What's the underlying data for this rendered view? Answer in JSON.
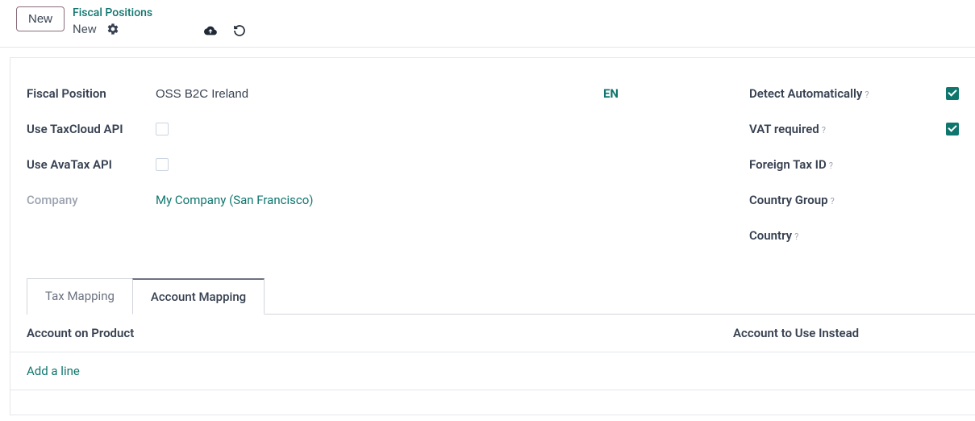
{
  "topbar": {
    "new_button": "New",
    "breadcrumb_parent": "Fiscal Positions",
    "breadcrumb_current": "New"
  },
  "form": {
    "left": {
      "fiscal_position_label": "Fiscal Position",
      "fiscal_position_value": "OSS B2C Ireland",
      "lang_badge": "EN",
      "use_taxcloud_label": "Use TaxCloud API",
      "use_taxcloud_checked": false,
      "use_avatax_label": "Use AvaTax API",
      "use_avatax_checked": false,
      "company_label": "Company",
      "company_value": "My Company (San Francisco)"
    },
    "right": {
      "detect_auto_label": "Detect Automatically",
      "detect_auto_checked": true,
      "vat_required_label": "VAT required",
      "vat_required_checked": true,
      "foreign_tax_label": "Foreign Tax ID",
      "country_group_label": "Country Group",
      "country_label": "Country"
    }
  },
  "tabs": {
    "tax_mapping": "Tax Mapping",
    "account_mapping": "Account Mapping",
    "active": "account_mapping"
  },
  "table": {
    "col_account_on_product": "Account on Product",
    "col_account_to_use": "Account to Use Instead",
    "add_line": "Add a line",
    "rows": []
  },
  "help_marker": "?"
}
